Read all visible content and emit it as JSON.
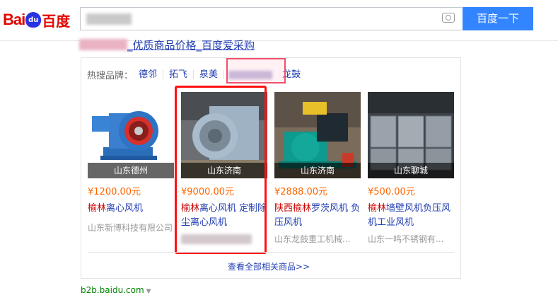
{
  "logo": {
    "bai": "Bai",
    "du": "du",
    "cn": "百度"
  },
  "search": {
    "button_label": "百度一下"
  },
  "result": {
    "title": "_优质商品价格_百度爱采购",
    "hot_brands_label": "热搜品牌：",
    "brands": [
      "德邻",
      "拓飞",
      "泉美",
      "龙鼓"
    ],
    "products": [
      {
        "location": "山东德州",
        "price": "¥1200.00元",
        "name_hl": "榆林",
        "name_rest": "离心风机",
        "shop": "山东新博科技有限公司"
      },
      {
        "location": "山东济南",
        "price": "¥9000.00元",
        "name_hl": "榆林",
        "name_rest": "离心风机 定制除尘离心风机",
        "shop": ""
      },
      {
        "location": "山东济南",
        "price": "¥2888.00元",
        "name_hl": "陕西榆林",
        "name_rest": "罗茨风机 负压风机",
        "shop": "山东龙鼓重工机械..."
      },
      {
        "location": "山东聊城",
        "price": "¥500.00元",
        "name_hl": "榆林",
        "name_rest": "墙壁风机负压风机工业风机",
        "shop": "山东一鸣不锈钢有..."
      }
    ],
    "more_link": "查看全部相关商品>>",
    "url": "b2b.baidu.com"
  },
  "colors": {
    "brand_red": "#e10602",
    "button_blue": "#3385ff",
    "link_blue": "#2440b3",
    "price_orange": "#ff6600",
    "frame_red": "#ff1111"
  }
}
